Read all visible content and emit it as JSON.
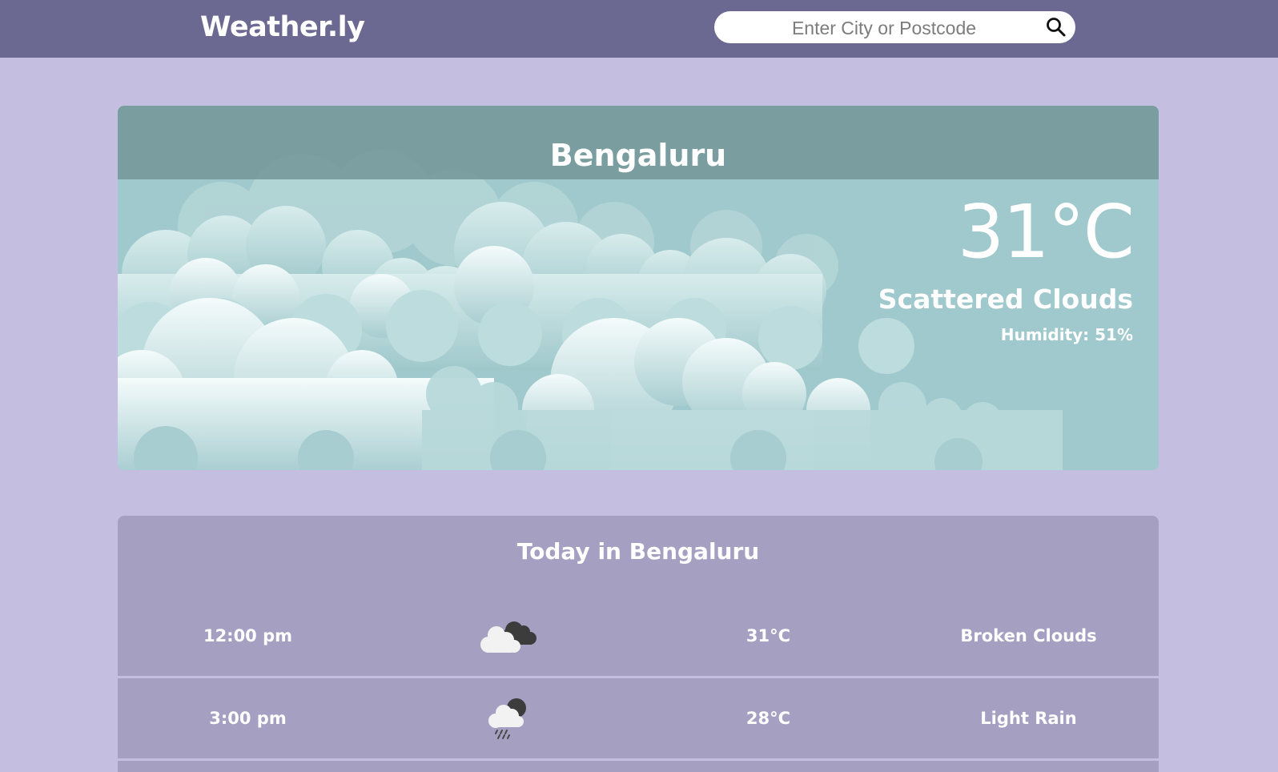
{
  "header": {
    "logo": "Weather.ly",
    "search_placeholder": "Enter City or Postcode",
    "search_icon": "search-icon"
  },
  "current": {
    "city": "Bengaluru",
    "temperature": "31°C",
    "condition": "Scattered Clouds",
    "humidity": "Humidity: 51%",
    "background": "clouds-illustration"
  },
  "today": {
    "title": "Today in Bengaluru",
    "rows": [
      {
        "time": "12:00 pm",
        "icon": "broken-clouds-icon",
        "temp": "31°C",
        "desc": "Broken Clouds"
      },
      {
        "time": "3:00 pm",
        "icon": "light-rain-icon",
        "temp": "28°C",
        "desc": "Light Rain"
      }
    ]
  },
  "colors": {
    "topbar": "#6b6892",
    "page_bg": "#c4bee0",
    "hero_sky": "#9fc9cc",
    "panel": "#a59fc2"
  }
}
